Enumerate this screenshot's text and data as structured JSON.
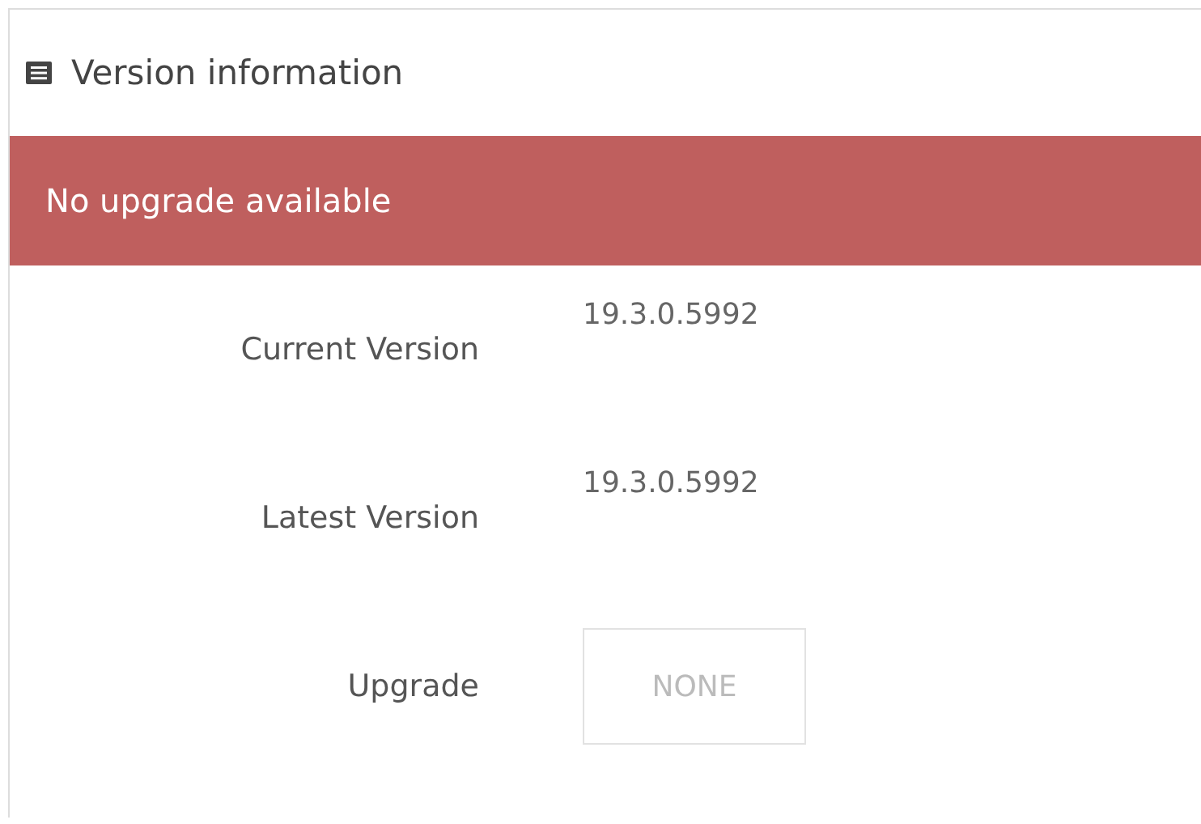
{
  "panel": {
    "title": "Version information"
  },
  "alert": {
    "text": "No upgrade available"
  },
  "fields": [
    {
      "label": "Current Version",
      "value": "19.3.0.5992"
    },
    {
      "label": "Latest Version",
      "value": "19.3.0.5992"
    }
  ],
  "upgrade": {
    "label": "Upgrade",
    "button": "NONE",
    "disabled": true
  }
}
